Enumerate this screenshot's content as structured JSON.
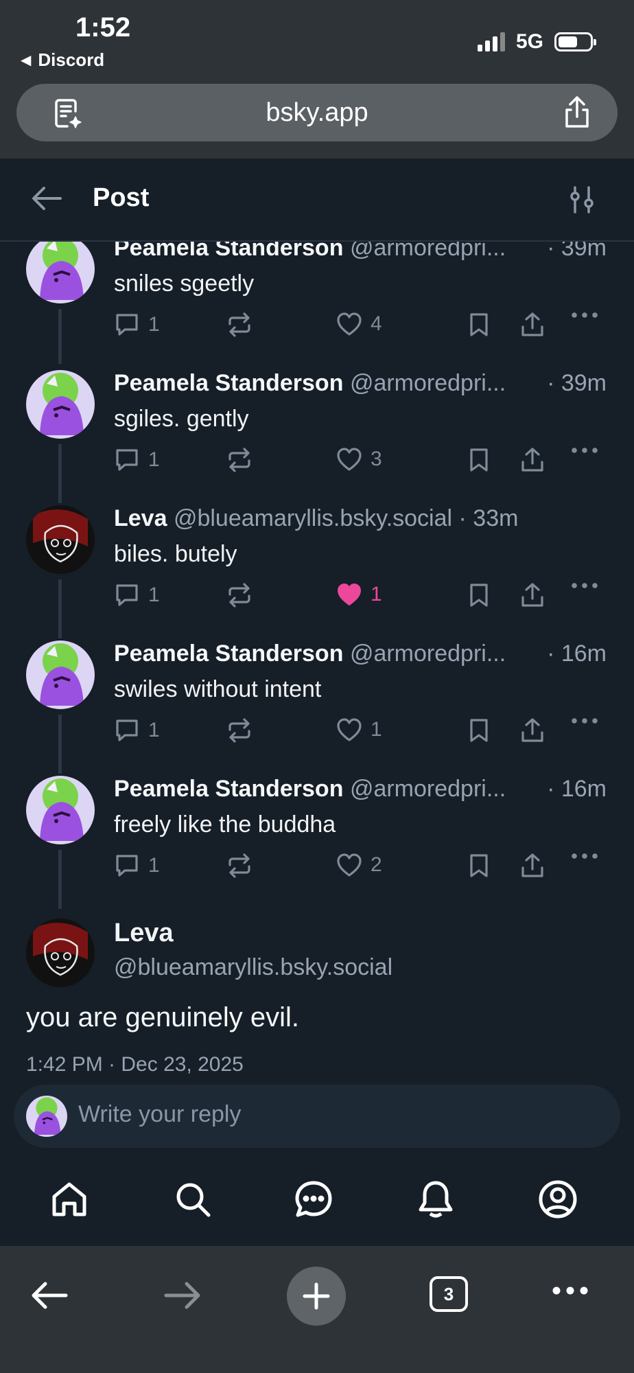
{
  "status_bar": {
    "time": "1:52",
    "back_app": "Discord",
    "network": "5G",
    "battery_level": 0.62
  },
  "browser": {
    "url": "bsky.app",
    "tab_count": "3"
  },
  "header": {
    "title": "Post"
  },
  "thread": [
    {
      "name": "Peamela Standerson",
      "handle": "@armoredpri...",
      "time": "· 39m",
      "text": "sniles sgeetly",
      "replies": "1",
      "likes": "4",
      "liked": false,
      "avatar": "purple"
    },
    {
      "name": "Peamela Standerson",
      "handle": "@armoredpri...",
      "time": "· 39m",
      "text": "sgiles. gently",
      "replies": "1",
      "likes": "3",
      "liked": false,
      "avatar": "purple"
    },
    {
      "name": "Leva",
      "handle": "@blueamaryllis.bsky.social",
      "time": "· 33m",
      "text": "biles. butely",
      "replies": "1",
      "likes": "1",
      "liked": true,
      "avatar": "dark"
    },
    {
      "name": "Peamela Standerson",
      "handle": "@armoredpri...",
      "time": "· 16m",
      "text": "swiles without intent",
      "replies": "1",
      "likes": "1",
      "liked": false,
      "avatar": "purple"
    },
    {
      "name": "Peamela Standerson",
      "handle": "@armoredpri...",
      "time": "· 16m",
      "text": "freely like the buddha",
      "replies": "1",
      "likes": "2",
      "liked": false,
      "avatar": "purple"
    }
  ],
  "main_post": {
    "name": "Leva",
    "handle": "@blueamaryllis.bsky.social",
    "text": "you are genuinely evil.",
    "datetime": "1:42 PM · Dec 23, 2025"
  },
  "reply": {
    "placeholder": "Write your reply"
  },
  "colors": {
    "background": "#161e27",
    "like_active": "#ec4899",
    "muted": "#98a4b3"
  }
}
